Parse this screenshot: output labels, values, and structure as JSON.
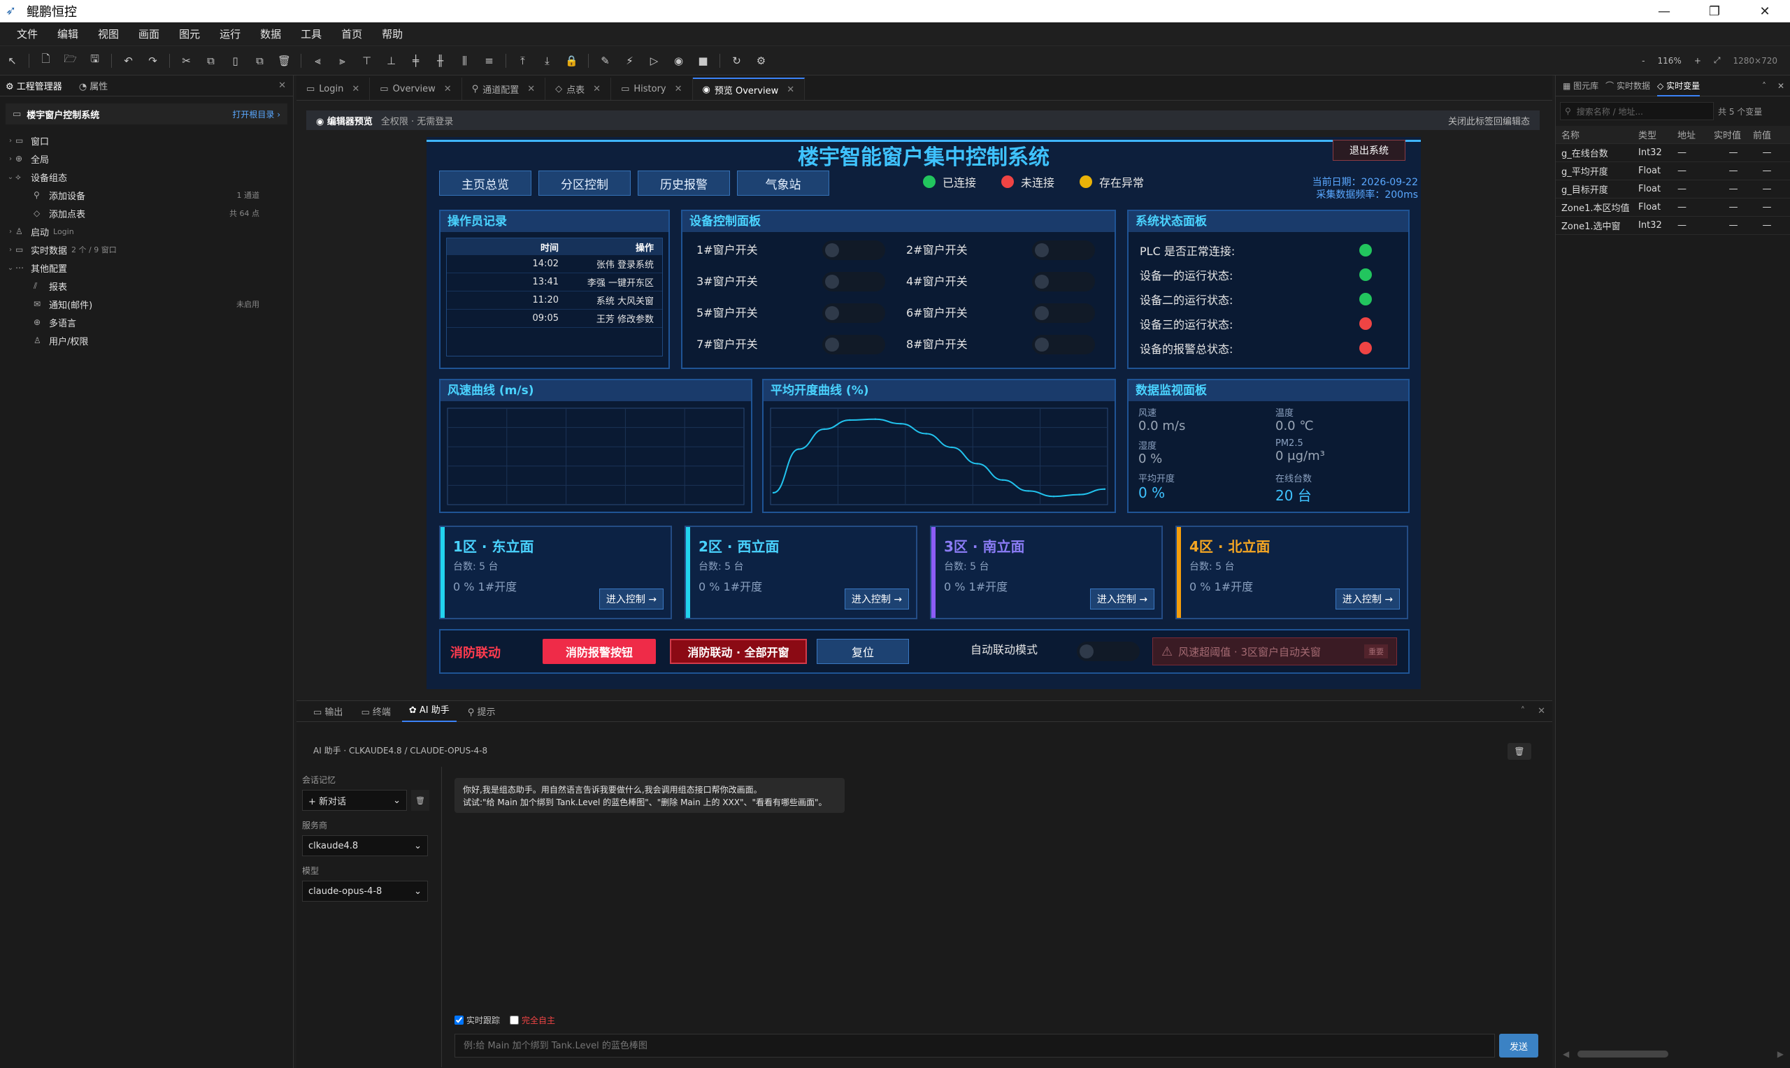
{
  "window": {
    "title": "鲲鹏恒控",
    "buttons": [
      "—",
      "❐",
      "✕"
    ]
  },
  "menu": [
    "文件",
    "编辑",
    "视图",
    "画面",
    "图元",
    "运行",
    "数据",
    "工具",
    "首页",
    "帮助"
  ],
  "toolbar": {
    "zoom": "116%",
    "resolution": "1280×720",
    "minus": "-",
    "plus": "+"
  },
  "left_panel": {
    "tabs": [
      "工程管理器",
      "属性"
    ],
    "project": "楼宇窗户控制系统",
    "open_dir": "打开根目录 ›",
    "tree": [
      {
        "label": "窗口",
        "meta": "",
        "caret": "›",
        "icon": "▭",
        "indent": 0
      },
      {
        "label": "全局",
        "meta": "",
        "caret": "›",
        "icon": "⊕",
        "indent": 0
      },
      {
        "label": "设备组态",
        "meta": "",
        "caret": "⌄",
        "icon": "⟡",
        "indent": 0
      },
      {
        "label": "添加设备",
        "meta": "1 通道",
        "caret": "",
        "icon": "⚲",
        "indent": 1
      },
      {
        "label": "添加点表",
        "meta": "共 64 点",
        "caret": "",
        "icon": "◇",
        "indent": 1
      },
      {
        "label": "启动",
        "meta": "",
        "caret": "›",
        "icon": "♙",
        "indent": 0,
        "sub": "Login"
      },
      {
        "label": "实时数据",
        "meta": "",
        "caret": "›",
        "icon": "▭",
        "indent": 0,
        "sub": "2 个 / 9 窗口"
      },
      {
        "label": "其他配置",
        "meta": "",
        "caret": "⌄",
        "icon": "⋯",
        "indent": 0
      },
      {
        "label": "报表",
        "meta": "",
        "caret": "",
        "icon": "⫽",
        "indent": 1
      },
      {
        "label": "通知(邮件)",
        "meta": "未启用",
        "caret": "",
        "icon": "✉",
        "indent": 1
      },
      {
        "label": "多语言",
        "meta": "",
        "caret": "",
        "icon": "⊕",
        "indent": 1
      },
      {
        "label": "用户/权限",
        "meta": "",
        "caret": "",
        "icon": "♙",
        "indent": 1
      }
    ]
  },
  "tabs": [
    {
      "label": "Login",
      "icon": "▭",
      "active": false
    },
    {
      "label": "Overview",
      "icon": "▭",
      "active": false
    },
    {
      "label": "通道配置",
      "icon": "⚲",
      "active": false
    },
    {
      "label": "点表",
      "icon": "◇",
      "active": false
    },
    {
      "label": "History",
      "icon": "▭",
      "active": false
    },
    {
      "label": "预览 Overview",
      "icon": "◉",
      "active": true
    }
  ],
  "preview_bar": {
    "label": "编辑器预览",
    "info": "全权限 · 无需登录",
    "close": "关闭此标签回编辑态"
  },
  "scada": {
    "title": "楼宇智能窗户集中控制系统",
    "logout": "退出系统",
    "nav": [
      "主页总览",
      "分区控制",
      "历史报警",
      "气象站"
    ],
    "legend": [
      {
        "label": "已连接",
        "color": "#22c55e"
      },
      {
        "label": "未连接",
        "color": "#ef4444"
      },
      {
        "label": "存在异常",
        "color": "#eab308"
      }
    ],
    "date": "当前日期：2026-09-22",
    "rate": "采集数据频率：200ms",
    "oplog": {
      "title": "操作员记录",
      "headers": [
        "时间",
        "操作"
      ],
      "rows": [
        [
          "14:02",
          "张伟 登录系统"
        ],
        [
          "13:41",
          "李强 一键开东区"
        ],
        [
          "11:20",
          "系统 大风关窗"
        ],
        [
          "09:05",
          "王芳 修改参数"
        ]
      ]
    },
    "devctl": {
      "title": "设备控制面板",
      "items": [
        "1#窗户开关",
        "2#窗户开关",
        "3#窗户开关",
        "4#窗户开关",
        "5#窗户开关",
        "6#窗户开关",
        "7#窗户开关",
        "8#窗户开关"
      ]
    },
    "sysstatus": {
      "title": "系统状态面板",
      "items": [
        {
          "label": "PLC 是否正常连接:",
          "color": "#22c55e"
        },
        {
          "label": "设备一的运行状态:",
          "color": "#22c55e"
        },
        {
          "label": "设备二的运行状态:",
          "color": "#22c55e"
        },
        {
          "label": "设备三的运行状态:",
          "color": "#ef4444"
        },
        {
          "label": "设备的报警总状态:",
          "color": "#ef4444"
        }
      ]
    },
    "wind_chart": {
      "title": "风速曲线 (m/s)"
    },
    "open_chart": {
      "title": "平均开度曲线 (%)"
    },
    "monitor": {
      "title": "数据监视面板",
      "cells": [
        {
          "label": "风速",
          "value": "0.0 m/s",
          "big": false
        },
        {
          "label": "温度",
          "value": "0.0 ℃",
          "big": false
        },
        {
          "label": "湿度",
          "value": "0 %",
          "big": false
        },
        {
          "label": "PM2.5",
          "value": "0 μg/m³",
          "big": false
        },
        {
          "label": "平均开度",
          "value": "0 %",
          "big": true
        },
        {
          "label": "在线台数",
          "value": "20 台",
          "big": true
        }
      ]
    },
    "zones": [
      {
        "title": "1区 · 东立面",
        "count": "台数: 5 台",
        "status": "0 % 1#开度",
        "btn": "进入控制 →",
        "color": "#22d3ee",
        "titlecolor": "#4ad3ff"
      },
      {
        "title": "2区 · 西立面",
        "count": "台数: 5 台",
        "status": "0 % 1#开度",
        "btn": "进入控制 →",
        "color": "#22d3ee",
        "titlecolor": "#4ad3ff"
      },
      {
        "title": "3区 · 南立面",
        "count": "台数: 5 台",
        "status": "0 % 1#开度",
        "btn": "进入控制 →",
        "color": "#8b5cf6",
        "titlecolor": "#8b7cf6"
      },
      {
        "title": "4区 · 北立面",
        "count": "台数: 5 台",
        "status": "0 % 1#开度",
        "btn": "进入控制 →",
        "color": "#f59e0b",
        "titlecolor": "#f5a623"
      }
    ],
    "fire": {
      "label": "消防联动",
      "alarm_btn": "消防报警按钮",
      "open_all_btn": "消防联动 · 全部开窗",
      "reset_btn": "复位",
      "auto_label": "自动联动模式",
      "warning": "风速超阈值 · 3区窗户自动关窗",
      "badge": "重要"
    }
  },
  "chart_data": [
    {
      "type": "line",
      "title": "风速曲线 (m/s)",
      "series": [],
      "grid": true
    },
    {
      "type": "line",
      "title": "平均开度曲线 (%)",
      "grid": true,
      "x": [
        0,
        1,
        2,
        3,
        4,
        5,
        6,
        7,
        8,
        9,
        10,
        11,
        12,
        13
      ],
      "series": [
        {
          "values": [
            10,
            58,
            80,
            90,
            91,
            86,
            75,
            60,
            42,
            24,
            12,
            6,
            8,
            14
          ]
        }
      ]
    }
  ],
  "bottom": {
    "tabs": [
      "输出",
      "终端",
      "AI 助手",
      "提示"
    ],
    "assistant_title": "AI 助手 · CLKAUDE4.8 / CLAUDE-OPUS-4-8",
    "history_label": "会话记忆",
    "new_chat": "+ 新对话",
    "provider_label": "服务商",
    "provider": "clkaude4.8",
    "model_label": "模型",
    "model": "claude-opus-4-8",
    "message_line1": "你好,我是组态助手。用自然语言告诉我要做什么,我会调用组态接口帮你改画面。",
    "message_line2": "试试:\"给 Main 加个绑到 Tank.Level 的蓝色棒图\"、\"删除 Main 上的 XXX\"、\"看看有哪些画面\"。",
    "opt_follow": "实时跟踪",
    "opt_auto": "完全自主",
    "input_placeholder": "例:给 Main 加个绑到 Tank.Level 的蓝色棒图",
    "send": "发送"
  },
  "right_panel": {
    "tabs": [
      "图元库",
      "实时数据",
      "实时变量"
    ],
    "search_placeholder": "搜索名称 / 地址...",
    "count": "共 5 个变量",
    "headers": [
      "名称",
      "类型",
      "地址",
      "实时值",
      "前值"
    ],
    "rows": [
      [
        "g_在线台数",
        "Int32",
        "—",
        "—"
      ],
      [
        "g_平均开度",
        "Float",
        "—",
        "—"
      ],
      [
        "g_目标开度",
        "Float",
        "—",
        "—"
      ],
      [
        "Zone1.本区均值",
        "Float",
        "—",
        "—"
      ],
      [
        "Zone1.选中窗",
        "Int32",
        "—",
        "—"
      ]
    ]
  }
}
